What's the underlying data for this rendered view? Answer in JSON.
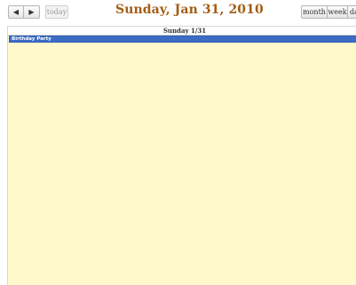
{
  "toolbar": {
    "prev_icon": "◀",
    "next_icon": "▶",
    "today_label": "today",
    "title": "Sunday, Jan 31, 2010",
    "view_buttons": {
      "month": "month",
      "week": "week",
      "day": "day"
    }
  },
  "calendar": {
    "day_header": "Sunday 1/31",
    "events": [
      {
        "title": "Birthday Party",
        "color": "#3c6cc3"
      }
    ],
    "background_color": "#fff9cc"
  },
  "colors": {
    "title": "#a45d14"
  }
}
